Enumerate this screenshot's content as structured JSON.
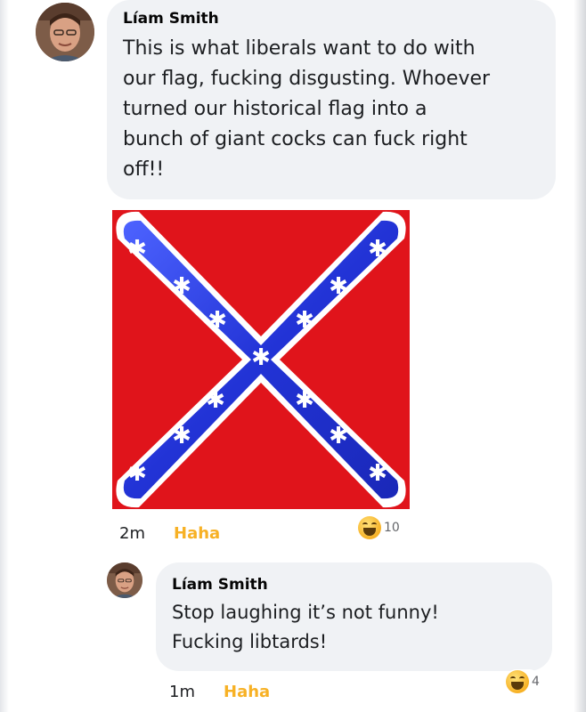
{
  "comments": [
    {
      "author": "Líam Smith",
      "text": "This is what liberals want to do with\nour flag, fucking disgusting. Whoever\nturned our historical flag into a\nbunch of giant cocks can fuck right\noff!!",
      "timestamp": "2m",
      "reaction_label": "Haha",
      "reaction_count": "10"
    },
    {
      "author": "Líam Smith",
      "text": "Stop laughing it’s not funny!\nFucking libtards!",
      "timestamp": "1m",
      "reaction_label": "Haha",
      "reaction_count": "4"
    }
  ],
  "colors": {
    "bubble": "#f0f2f5",
    "haha": "#f7b125",
    "flag_red": "#e0141b",
    "flag_blue": "#2233d6"
  },
  "icons": [
    "avatar",
    "haha-reaction-icon",
    "star-icon"
  ]
}
